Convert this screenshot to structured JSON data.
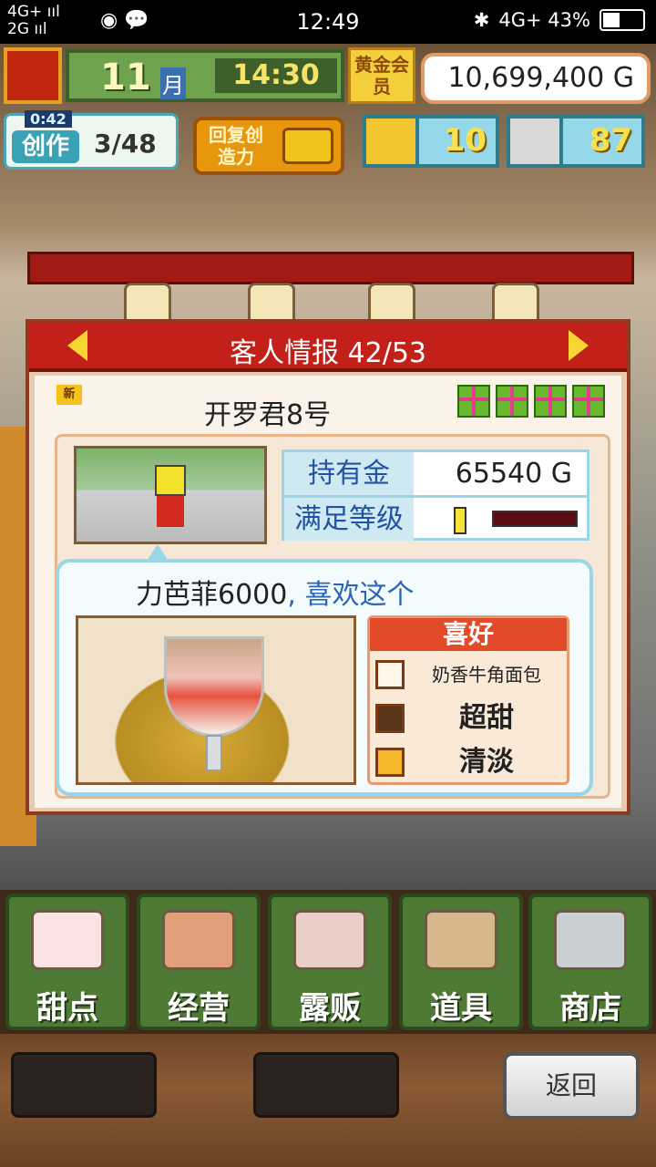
{
  "status_bar": {
    "network_top": "4G+ ııl",
    "network_bottom": "2G ııl",
    "time": "12:49",
    "right": "4G+ 43%"
  },
  "hud": {
    "month": "11",
    "month_unit": "月",
    "clock": "14:30",
    "gold_member": "黄金会员",
    "money": "10,699,400 G",
    "creation_timer": "0:42",
    "creation_label": "创作",
    "creation_count": "3/48",
    "recover_label": "回复创造力",
    "gold_bars": "10",
    "coins": "87"
  },
  "dialog": {
    "title": "客人情报 42/53",
    "new_badge": "新",
    "customer_name": "开罗君8号",
    "gifts_count": 4,
    "money_label": "持有金",
    "money_value": "65540 G",
    "satisfaction_label": "满足等级",
    "satisfaction_level": 0.05,
    "speech_item": "力芭菲6000",
    "speech_sep": ",",
    "speech_like": "喜欢这个",
    "prefs_title": "喜好",
    "prefs": [
      {
        "icon": "croissant-icon",
        "text": "奶香牛角面包"
      },
      {
        "icon": "chocolate-icon",
        "text": "超甜"
      },
      {
        "icon": "cube-icon",
        "text": "清淡"
      }
    ]
  },
  "menu": [
    {
      "name": "menu-desserts",
      "icon": "cake-icon",
      "label": "甜点"
    },
    {
      "name": "menu-management",
      "icon": "shop-icon",
      "label": "经营"
    },
    {
      "name": "menu-stall",
      "icon": "truck-icon",
      "label": "露贩"
    },
    {
      "name": "menu-items",
      "icon": "gear-bag-icon",
      "label": "道具"
    },
    {
      "name": "menu-store",
      "icon": "cart-icon",
      "label": "商店"
    }
  ],
  "back_button": "返回",
  "colors": {
    "accent_red": "#c22018",
    "hud_green": "#6fa24c",
    "highlight_blue": "#2a66b8"
  }
}
